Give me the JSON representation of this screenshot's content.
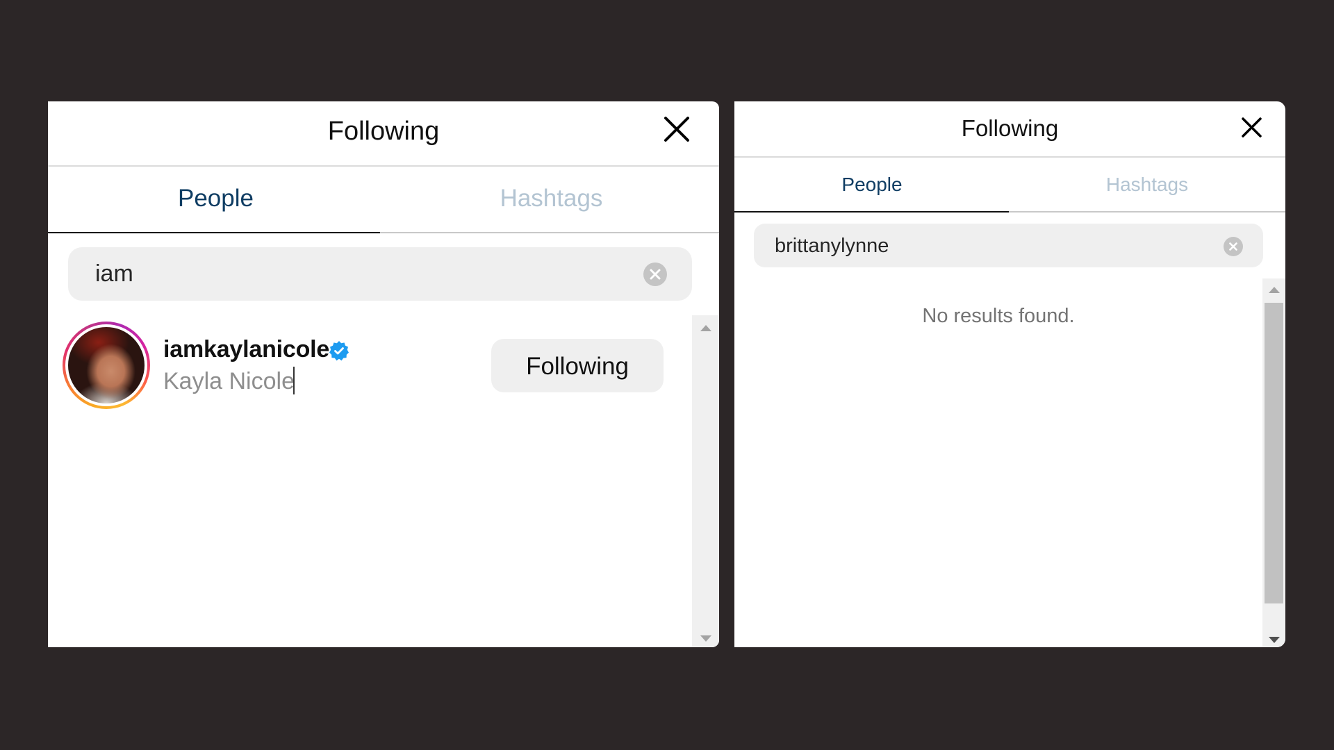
{
  "left_panel": {
    "title": "Following",
    "close_icon": "close-icon",
    "tabs": [
      {
        "label": "People",
        "active": true
      },
      {
        "label": "Hashtags",
        "active": false
      }
    ],
    "search": {
      "value": "iam",
      "clear_icon": "clear-circle-icon"
    },
    "results": [
      {
        "username": "iamkaylanicole",
        "verified": true,
        "full_name": "Kayla Nicole",
        "button_label": "Following",
        "avatar_icon": "avatar-with-story-ring"
      }
    ]
  },
  "right_panel": {
    "title": "Following",
    "close_icon": "close-icon",
    "tabs": [
      {
        "label": "People",
        "active": true
      },
      {
        "label": "Hashtags",
        "active": false
      }
    ],
    "search": {
      "value": "brittanylynne",
      "clear_icon": "clear-circle-icon"
    },
    "empty_message": "No results found."
  },
  "colors": {
    "background": "#2c2627",
    "active_tab": "#0f3d63",
    "inactive_tab": "#b3c4d2",
    "verified_badge": "#1d9bf0",
    "search_bg": "#efefef",
    "secondary_text": "#8e8e8e"
  }
}
